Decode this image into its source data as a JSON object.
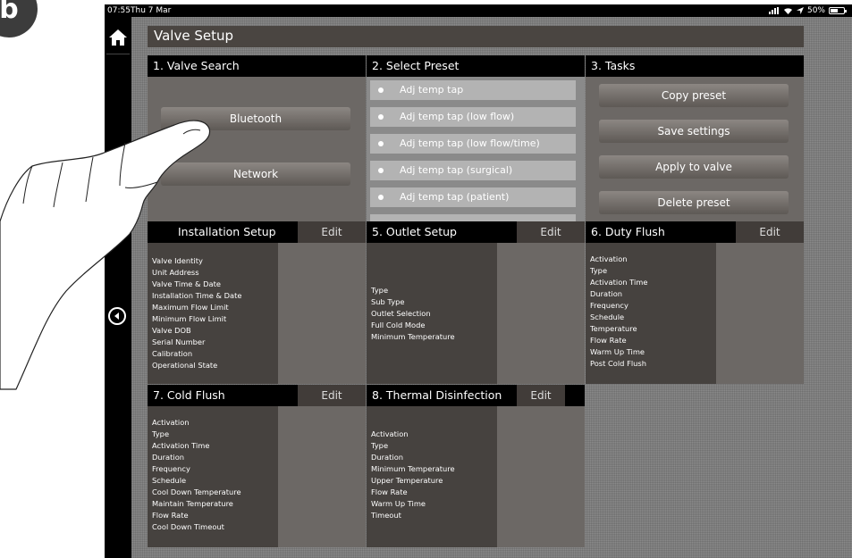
{
  "figure_label": "b",
  "status_bar": {
    "time": "07:55",
    "date": "Thu 7 Mar",
    "battery": "50%"
  },
  "page_title": "Valve Setup",
  "sections": {
    "valve_search": {
      "title": "1. Valve Search",
      "buttons": [
        "Bluetooth",
        "Network"
      ]
    },
    "select_preset": {
      "title": "2. Select Preset",
      "presets": [
        "Adj temp tap",
        "Adj temp tap (low flow)",
        "Adj temp tap (low flow/time)",
        "Adj temp tap (surgical)",
        "Adj temp tap (patient)"
      ]
    },
    "tasks": {
      "title": "3. Tasks",
      "buttons": [
        "Copy preset",
        "Save settings",
        "Apply to valve",
        "Delete preset"
      ]
    },
    "installation_setup": {
      "title": "Installation Setup",
      "edit": "Edit",
      "items": [
        "Valve Identity",
        "Unit Address",
        "Valve Time & Date",
        "Installation Time & Date",
        "Maximum Flow Limit",
        "Minimum Flow Limit",
        "Valve DOB",
        "Serial Number",
        "Calibration",
        "Operational State"
      ]
    },
    "outlet_setup": {
      "title": "5. Outlet Setup",
      "edit": "Edit",
      "items": [
        "Type",
        "Sub Type",
        "Outlet Selection",
        "Full Cold Mode",
        "Minimum Temperature"
      ]
    },
    "duty_flush": {
      "title": "6. Duty Flush",
      "edit": "Edit",
      "items": [
        "Activation",
        "Type",
        "Activation Time",
        "Duration",
        "Frequency",
        "Schedule",
        "Temperature",
        "Flow Rate",
        "Warm Up Time",
        "Post Cold Flush"
      ]
    },
    "cold_flush": {
      "title": "7. Cold Flush",
      "edit": "Edit",
      "items": [
        "Activation",
        "Type",
        "Activation Time",
        "Duration",
        "Frequency",
        "Schedule",
        "Cool Down Temperature",
        "Maintain Temperature",
        "Flow Rate",
        "Cool Down Timeout"
      ]
    },
    "thermal_disinfection": {
      "title": "8. Thermal Disinfection",
      "edit": "Edit",
      "items": [
        "Activation",
        "Type",
        "Duration",
        "Minimum Temperature",
        "Upper Temperature",
        "Flow Rate",
        "Warm Up Time",
        "Timeout"
      ]
    }
  },
  "icons": {
    "home": "home-icon",
    "back": "back-arrow-icon",
    "signal": "signal-icon",
    "wifi": "wifi-icon",
    "location": "location-icon",
    "battery": "battery-icon"
  }
}
